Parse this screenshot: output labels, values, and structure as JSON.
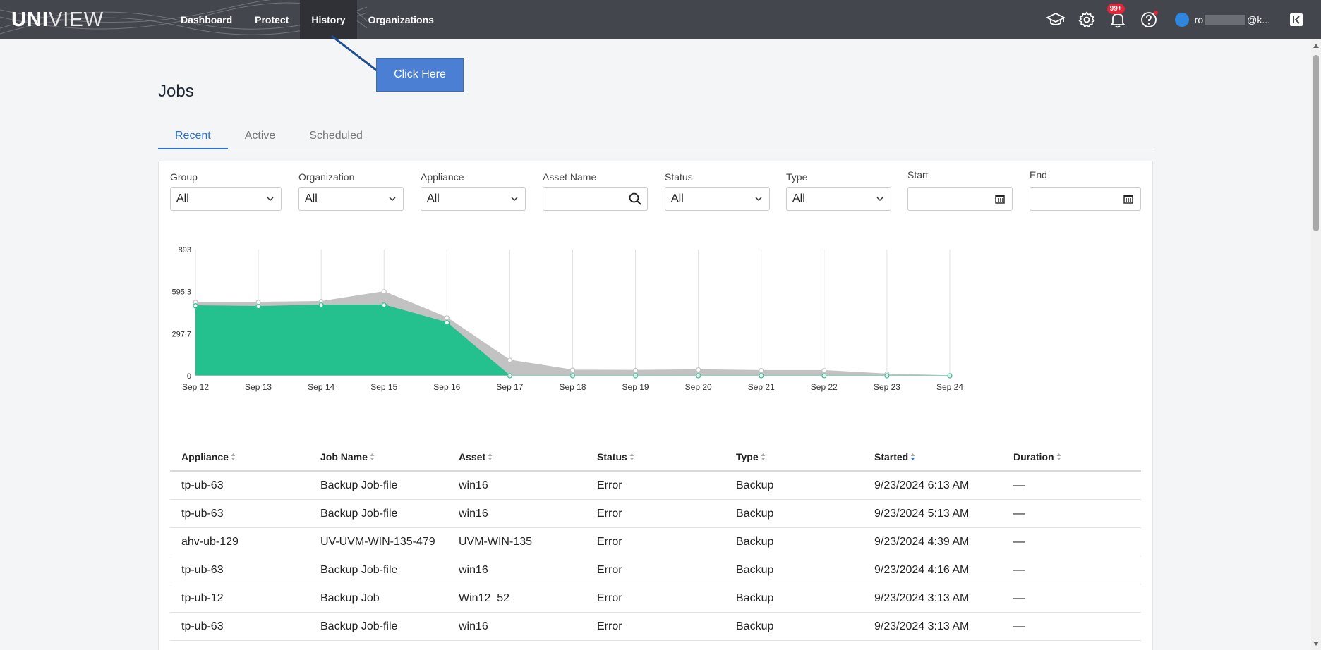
{
  "app": {
    "logo_bold": "UNI",
    "logo_light": "VIEW"
  },
  "nav": {
    "items": [
      {
        "label": "Dashboard"
      },
      {
        "label": "Protect"
      },
      {
        "label": "History"
      },
      {
        "label": "Organizations"
      }
    ],
    "active": "History"
  },
  "topbar": {
    "notifications_badge": "99+",
    "user_prefix": "ro",
    "user_suffix": "@k...",
    "icons": [
      "graduation-cap-icon",
      "gear-icon",
      "bell-icon",
      "help-icon",
      "avatar",
      "collapse-icon"
    ]
  },
  "callout": {
    "label": "Click Here"
  },
  "page": {
    "title": "Jobs"
  },
  "tabs": [
    {
      "label": "Recent"
    },
    {
      "label": "Active"
    },
    {
      "label": "Scheduled"
    }
  ],
  "filters": {
    "group": {
      "label": "Group",
      "value": "All"
    },
    "organization": {
      "label": "Organization",
      "value": "All"
    },
    "appliance": {
      "label": "Appliance",
      "value": "All"
    },
    "asset_name": {
      "label": "Asset Name",
      "value": ""
    },
    "status": {
      "label": "Status",
      "value": "All"
    },
    "type": {
      "label": "Type",
      "value": "All"
    },
    "start": {
      "label": "Start",
      "value": ""
    },
    "end": {
      "label": "End",
      "value": ""
    }
  },
  "chart_data": {
    "type": "area",
    "categories": [
      "Sep 12",
      "Sep 13",
      "Sep 14",
      "Sep 15",
      "Sep 16",
      "Sep 17",
      "Sep 18",
      "Sep 19",
      "Sep 20",
      "Sep 21",
      "Sep 22",
      "Sep 23",
      "Sep 24"
    ],
    "y_ticks": [
      "893",
      "595.3",
      "297.7",
      "0"
    ],
    "ylim": [
      0,
      893
    ],
    "grid": "vertical",
    "series": [
      {
        "color": "#c2c2c2",
        "values": [
          520,
          520,
          525,
          595,
          410,
          110,
          40,
          38,
          42,
          37,
          37,
          12,
          0
        ]
      },
      {
        "color": "#24c18e",
        "values": [
          495,
          490,
          500,
          500,
          375,
          0,
          0,
          0,
          0,
          0,
          0,
          0,
          0
        ]
      }
    ]
  },
  "table": {
    "columns": [
      "Appliance",
      "Job Name",
      "Asset",
      "Status",
      "Type",
      "Started",
      "Duration"
    ],
    "sorted_column": "Started",
    "rows": [
      [
        "tp-ub-63",
        "Backup Job-file",
        "win16",
        "Error",
        "Backup",
        "9/23/2024 6:13 AM",
        "—"
      ],
      [
        "tp-ub-63",
        "Backup Job-file",
        "win16",
        "Error",
        "Backup",
        "9/23/2024 5:13 AM",
        "—"
      ],
      [
        "ahv-ub-129",
        "UV-UVM-WIN-135-479",
        "UVM-WIN-135",
        "Error",
        "Backup",
        "9/23/2024 4:39 AM",
        "—"
      ],
      [
        "tp-ub-63",
        "Backup Job-file",
        "win16",
        "Error",
        "Backup",
        "9/23/2024 4:16 AM",
        "—"
      ],
      [
        "tp-ub-12",
        "Backup Job",
        "Win12_52",
        "Error",
        "Backup",
        "9/23/2024 3:13 AM",
        "—"
      ],
      [
        "tp-ub-63",
        "Backup Job-file",
        "win16",
        "Error",
        "Backup",
        "9/23/2024 3:13 AM",
        "—"
      ]
    ]
  }
}
